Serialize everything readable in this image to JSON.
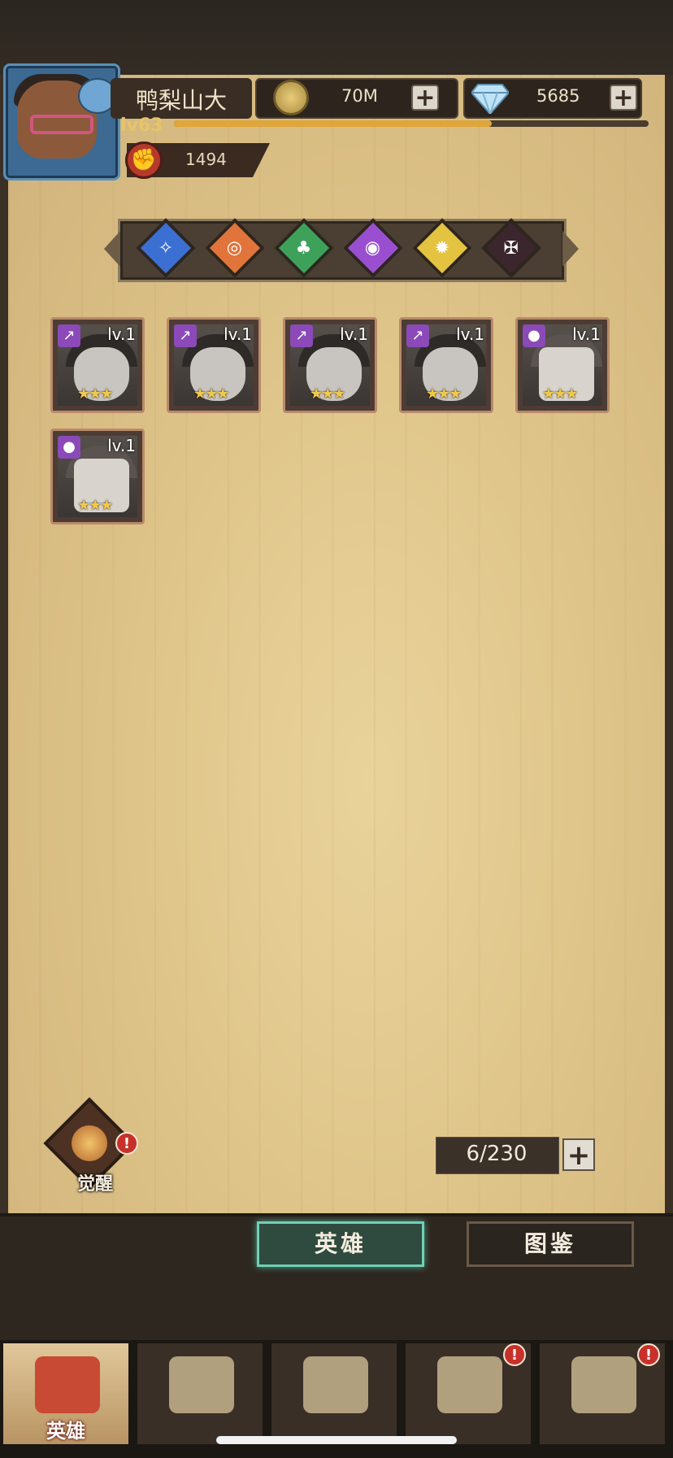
{
  "player": {
    "name": "鸭梨山大",
    "level": "lv63",
    "xp_fraction": 0.67,
    "power": "1494"
  },
  "resources": {
    "gold": "70M",
    "diamonds": "5685"
  },
  "factions": [
    {
      "name": "blue-faction",
      "color": "#3b6fd2",
      "glyph": "✧"
    },
    {
      "name": "orange-faction",
      "color": "#e0743a",
      "glyph": "◎"
    },
    {
      "name": "green-faction",
      "color": "#3ea15a",
      "glyph": "♣"
    },
    {
      "name": "purple-faction",
      "color": "#9a4fd1",
      "glyph": "◉"
    },
    {
      "name": "yellow-faction",
      "color": "#e4c341",
      "glyph": "✹"
    },
    {
      "name": "dark-faction",
      "color": "#3a262c",
      "glyph": "✠"
    }
  ],
  "heroes": [
    {
      "level": "lv.1",
      "stars": "★★★",
      "type": "hooded"
    },
    {
      "level": "lv.1",
      "stars": "★★★",
      "type": "hooded"
    },
    {
      "level": "lv.1",
      "stars": "★★★",
      "type": "hooded"
    },
    {
      "level": "lv.1",
      "stars": "★★★",
      "type": "hooded"
    },
    {
      "level": "lv.1",
      "stars": "★★★",
      "type": "mummy"
    },
    {
      "level": "lv.1",
      "stars": "★★★",
      "type": "mummy"
    }
  ],
  "awaken": {
    "label": "觉醒",
    "alert": "!"
  },
  "capacity": "6/230",
  "tabs": {
    "heroes": "英雄",
    "codex": "图鉴"
  },
  "nav": [
    {
      "label": "英雄",
      "icon": "helmet-icon",
      "active": true,
      "alert": ""
    },
    {
      "label": "",
      "icon": "banner-icon",
      "active": false,
      "alert": ""
    },
    {
      "label": "",
      "icon": "crossed-swords-icon",
      "active": false,
      "alert": ""
    },
    {
      "label": "",
      "icon": "castle-icon",
      "active": false,
      "alert": "!"
    },
    {
      "label": "",
      "icon": "guild-handshake-icon",
      "active": false,
      "alert": "!"
    }
  ]
}
